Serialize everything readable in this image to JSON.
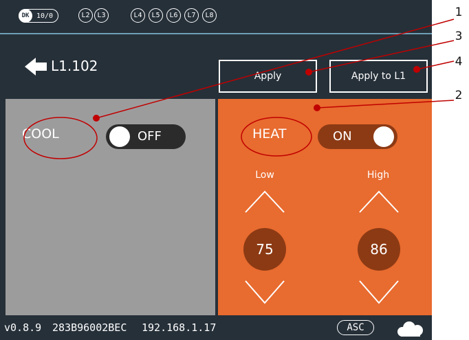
{
  "status_bar": {
    "dk_label": "DK",
    "dk_value": "10/0",
    "levels": [
      "L2",
      "L3",
      "L4",
      "L5",
      "L6",
      "L7",
      "L8"
    ]
  },
  "header": {
    "room_name": "L1.102",
    "apply_label": "Apply",
    "apply_to_label": "Apply to L1"
  },
  "cool": {
    "mode_label": "COOL",
    "toggle_state": "OFF"
  },
  "heat": {
    "mode_label": "HEAT",
    "toggle_state": "ON",
    "low_label": "Low",
    "high_label": "High",
    "low_setpoint": "75",
    "high_setpoint": "86"
  },
  "footer": {
    "version": "v0.8.9",
    "device_id": "283B96002BEC",
    "ip": "192.168.1.17",
    "mode_badge": "ASC"
  },
  "annotations": {
    "callouts": [
      "1",
      "2",
      "3",
      "4"
    ],
    "color": "#c00000"
  },
  "colors": {
    "background": "#263039",
    "cool_panel": "#9d9c9d",
    "heat_panel": "#e86b2f",
    "setpoint_circle": "#8c3a14",
    "divider": "#6f9fb4"
  }
}
